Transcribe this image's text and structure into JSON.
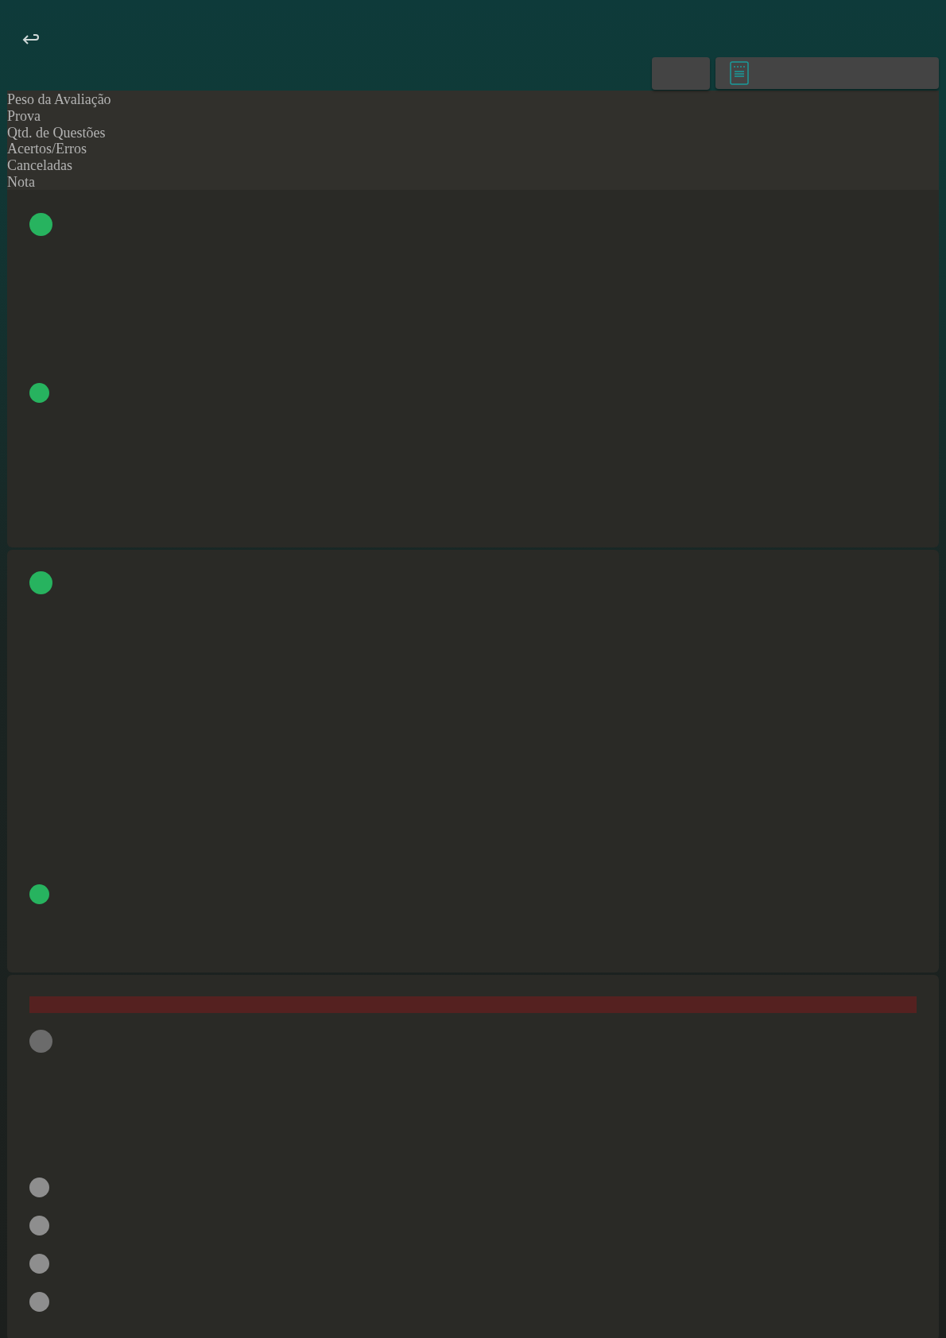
{
  "header_labels": [
    "Peso da Avaliação",
    "Prova",
    "Qtd. de Questões",
    "Acertos/Erros",
    "Canceladas",
    "Nota"
  ],
  "cards": [
    {
      "alert": false,
      "items": [
        {
          "kind": "large",
          "color": "#27b35f"
        },
        {
          "kind": "small",
          "color": "#27b35f"
        }
      ]
    },
    {
      "alert": false,
      "items": [
        {
          "kind": "large",
          "color": "#27b35f"
        },
        {
          "kind": "small",
          "color": "#27b35f"
        }
      ]
    },
    {
      "alert": true,
      "items": [
        {
          "kind": "large",
          "color": "#6b6b6b"
        },
        {
          "kind": "small",
          "color": "#8e8e8e"
        },
        {
          "kind": "small",
          "color": "#8e8e8e"
        },
        {
          "kind": "small",
          "color": "#8e8e8e"
        },
        {
          "kind": "small",
          "color": "#8e8e8e"
        }
      ]
    }
  ]
}
